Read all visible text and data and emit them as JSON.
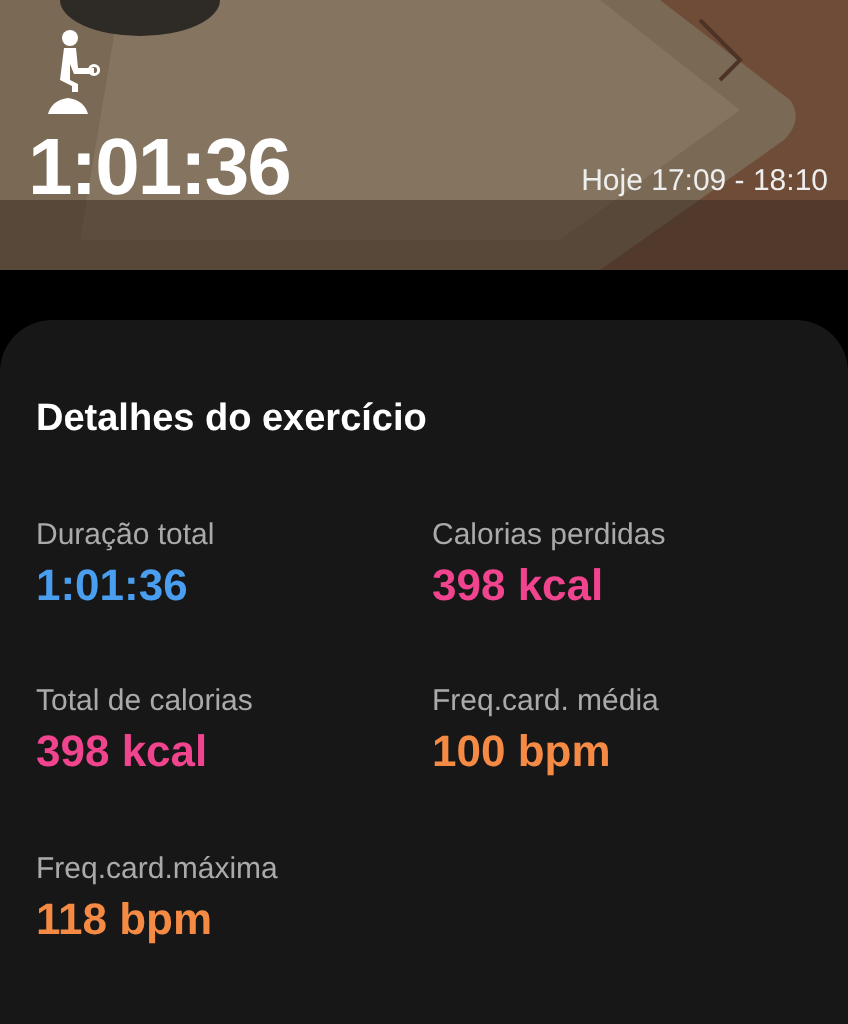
{
  "header": {
    "kind": "picture",
    "duration": "1:01:36",
    "time_range": "Hoje 17:09 - 18:10"
  },
  "details": {
    "title": "Detalhes do exercício",
    "stats": [
      {
        "label": "Duração total",
        "value": "1:01:36",
        "color": "#4a9ef0"
      },
      {
        "label": "Calorias perdidas",
        "value": "398 kcal",
        "color": "#f0448f"
      },
      {
        "label": "Total de calorias",
        "value": "398 kcal",
        "color": "#f0448f"
      },
      {
        "label": "Freq.card. média",
        "value": "100 bpm",
        "color": "#f58a45"
      },
      {
        "label": "Freq.card.máxima",
        "value": "118 bpm",
        "color": "#f58a45"
      }
    ]
  }
}
